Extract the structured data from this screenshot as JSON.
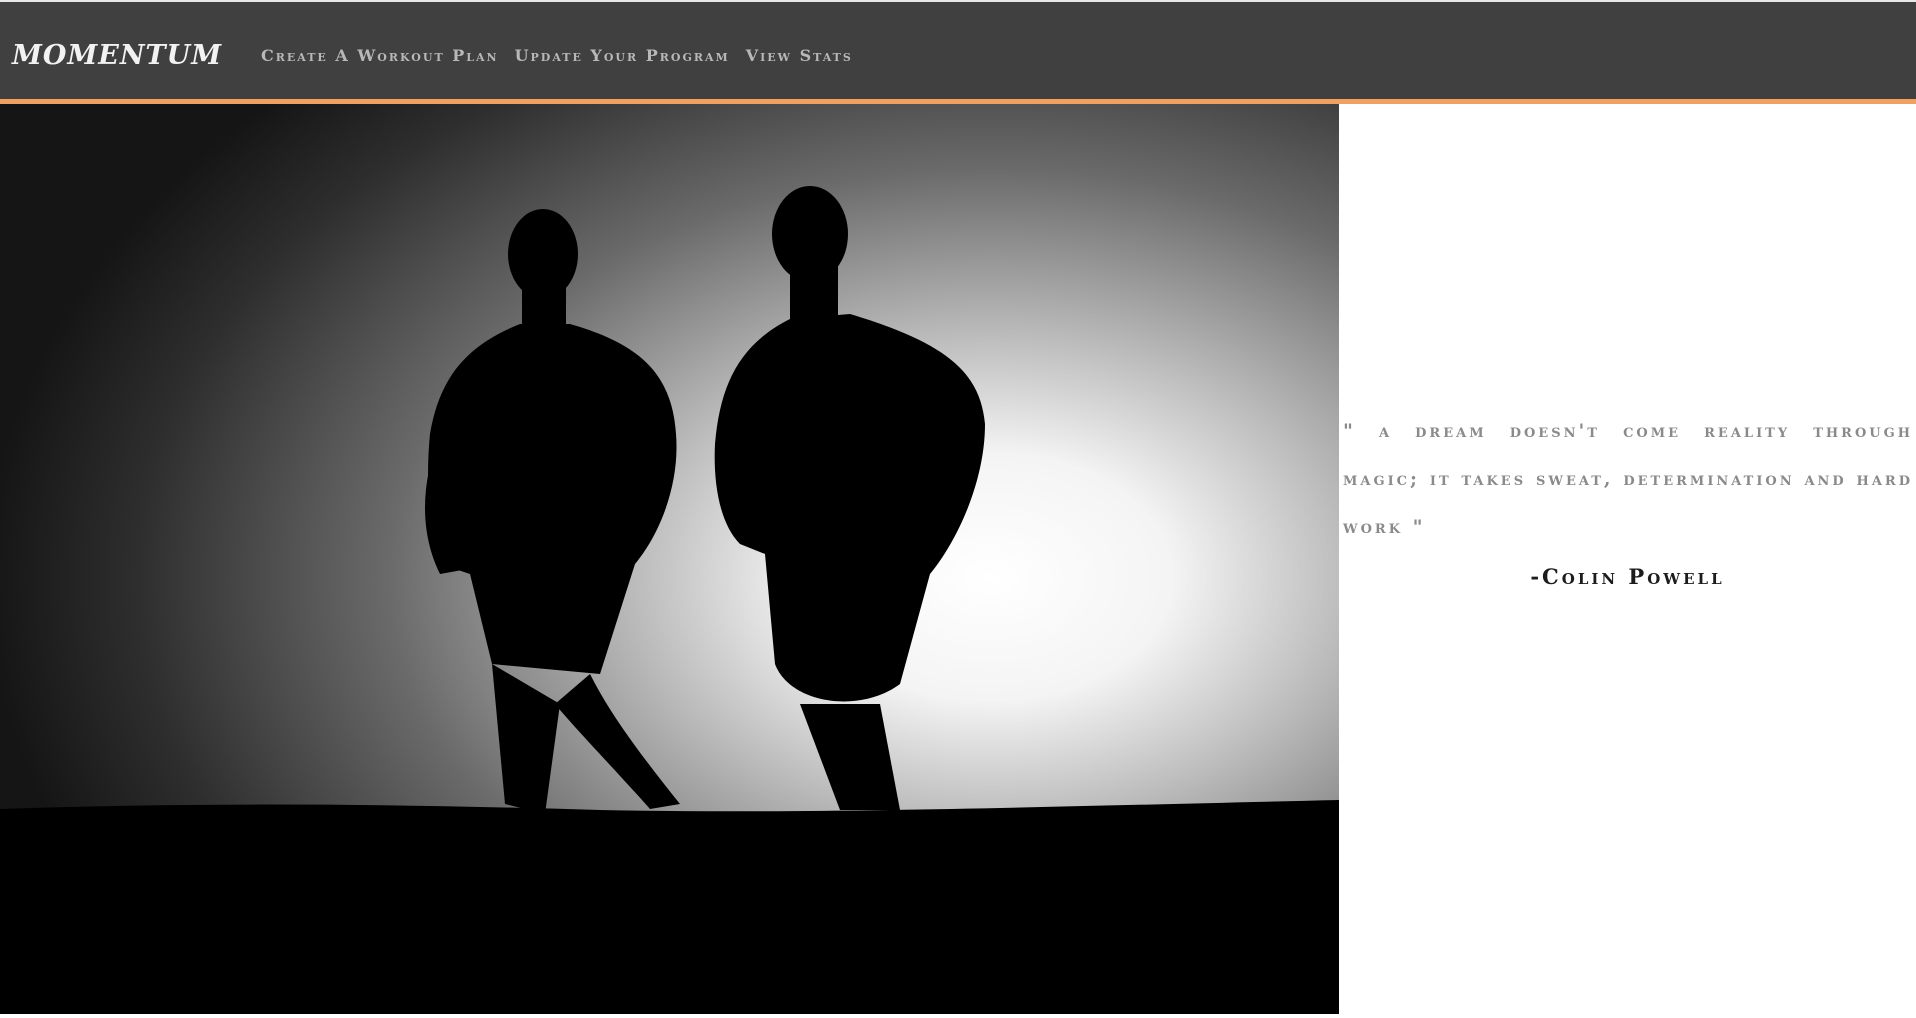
{
  "nav": {
    "brand": "MOMENTUM",
    "links": [
      "Create A Workout Plan",
      "Update Your Program",
      "View Stats"
    ]
  },
  "quote": {
    "text": "\" A dream doesn't come reality through magic; it takes sweat, determination and hard work \"",
    "author": "-Colin Powell"
  },
  "colors": {
    "navbar": "#404040",
    "accent": "#f0a060",
    "nav_text": "#b8b8b8",
    "quote_text": "#8a8a8a"
  }
}
